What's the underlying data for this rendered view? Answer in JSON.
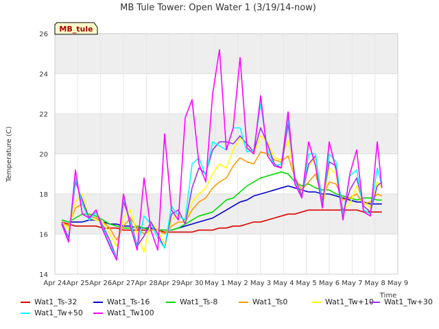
{
  "chart_data": {
    "type": "line",
    "title": "MB Tule Tower: Open Water 1 (3/19/14-now)",
    "xlabel": "Time",
    "ylabel": "Temperature (C)",
    "ylim": [
      14,
      26
    ],
    "yticks": [
      14,
      16,
      18,
      20,
      22,
      24,
      26
    ],
    "xticks": [
      "Apr 24",
      "Apr 25",
      "Apr 26",
      "Apr 27",
      "Apr 28",
      "Apr 29",
      "Apr 30",
      "May 1",
      "May 2",
      "May 3",
      "May 4",
      "May 5",
      "May 6",
      "May 7",
      "May 8",
      "May 9"
    ],
    "xlim_days": [
      0,
      15
    ],
    "station_label": "MB_tule",
    "legend_position": "bottom",
    "grid": true,
    "x": [
      0.3,
      0.6,
      0.9,
      1.2,
      1.5,
      1.8,
      2.1,
      2.4,
      2.7,
      3.0,
      3.3,
      3.6,
      3.9,
      4.2,
      4.5,
      4.8,
      5.1,
      5.4,
      5.7,
      6.0,
      6.3,
      6.6,
      6.9,
      7.2,
      7.5,
      7.8,
      8.1,
      8.4,
      8.7,
      9.0,
      9.3,
      9.6,
      9.9,
      10.2,
      10.5,
      10.8,
      11.1,
      11.4,
      11.7,
      12.0,
      12.3,
      12.6,
      12.9,
      13.2,
      13.5,
      13.8,
      14.1,
      14.3
    ],
    "series": [
      {
        "name": "Wat1_Ts-32",
        "color": "#dd0000",
        "values": [
          16.6,
          16.5,
          16.4,
          16.4,
          16.4,
          16.4,
          16.3,
          16.3,
          16.3,
          16.2,
          16.2,
          16.2,
          16.2,
          16.2,
          16.2,
          16.1,
          16.1,
          16.1,
          16.1,
          16.1,
          16.2,
          16.2,
          16.2,
          16.3,
          16.3,
          16.4,
          16.4,
          16.5,
          16.6,
          16.6,
          16.7,
          16.8,
          16.9,
          17.0,
          17.0,
          17.1,
          17.2,
          17.2,
          17.2,
          17.2,
          17.2,
          17.2,
          17.2,
          17.2,
          17.1,
          17.1,
          17.1,
          17.1
        ]
      },
      {
        "name": "Wat1_Ts-16",
        "color": "#0000cc",
        "values": [
          16.7,
          16.6,
          16.6,
          16.6,
          16.7,
          16.7,
          16.6,
          16.5,
          16.5,
          16.4,
          16.4,
          16.3,
          16.3,
          16.3,
          16.2,
          16.2,
          16.2,
          16.3,
          16.4,
          16.5,
          16.6,
          16.7,
          16.8,
          17.0,
          17.2,
          17.4,
          17.6,
          17.7,
          17.9,
          18.0,
          18.1,
          18.2,
          18.3,
          18.4,
          18.3,
          18.2,
          18.1,
          18.1,
          18.0,
          18.0,
          17.9,
          17.8,
          17.7,
          17.6,
          17.6,
          17.5,
          17.5,
          17.5
        ]
      },
      {
        "name": "Wat1_Ts-8",
        "color": "#00dd00",
        "values": [
          16.7,
          16.6,
          16.8,
          17.0,
          17.0,
          16.9,
          16.7,
          16.5,
          16.4,
          16.3,
          16.3,
          16.4,
          16.3,
          16.2,
          16.2,
          16.2,
          16.2,
          16.3,
          16.5,
          16.7,
          16.9,
          17.0,
          17.1,
          17.4,
          17.7,
          17.8,
          18.1,
          18.4,
          18.6,
          18.8,
          18.9,
          19.0,
          19.1,
          19.0,
          18.6,
          18.4,
          18.5,
          18.3,
          18.2,
          18.2,
          18.0,
          17.9,
          17.8,
          17.7,
          17.8,
          17.8,
          17.7,
          17.7
        ]
      },
      {
        "name": "Wat1_Ts0",
        "color": "#ff9900",
        "values": [
          16.6,
          16.4,
          17.3,
          17.5,
          16.9,
          16.8,
          16.6,
          16.3,
          15.7,
          16.4,
          16.8,
          16.3,
          16.0,
          16.2,
          16.2,
          16.0,
          16.4,
          16.6,
          16.6,
          17.2,
          17.6,
          17.8,
          18.3,
          18.6,
          18.8,
          19.4,
          19.8,
          19.6,
          19.5,
          20.1,
          20.0,
          19.7,
          19.6,
          19.9,
          18.8,
          18.2,
          18.6,
          19.0,
          17.8,
          18.6,
          18.5,
          17.7,
          17.8,
          18.0,
          17.5,
          17.6,
          18.0,
          17.9
        ]
      },
      {
        "name": "Wat1_Tw+10",
        "color": "#ffff00",
        "values": [
          16.6,
          16.2,
          17.6,
          18.0,
          16.8,
          16.7,
          16.6,
          16.0,
          15.4,
          16.8,
          17.2,
          16.0,
          15.1,
          16.6,
          16.2,
          15.5,
          16.7,
          17.0,
          16.6,
          17.6,
          18.0,
          18.3,
          19.0,
          19.5,
          19.3,
          20.2,
          20.8,
          20.3,
          20.0,
          20.9,
          20.6,
          19.8,
          19.7,
          20.7,
          18.7,
          18.0,
          19.4,
          19.8,
          17.3,
          19.3,
          19.0,
          17.2,
          17.5,
          18.4,
          17.6,
          17.3,
          18.6,
          18.3
        ]
      },
      {
        "name": "Wat1_Tw+30",
        "color": "#9933ee",
        "values": [
          16.6,
          15.8,
          18.6,
          17.7,
          16.8,
          17.1,
          16.4,
          15.7,
          14.8,
          17.6,
          16.7,
          15.4,
          15.9,
          16.6,
          16.0,
          15.3,
          17.0,
          17.2,
          16.5,
          18.3,
          19.3,
          19.0,
          20.2,
          20.6,
          20.6,
          20.5,
          20.9,
          20.5,
          20.1,
          21.3,
          20.5,
          19.5,
          19.3,
          21.5,
          18.8,
          17.9,
          19.5,
          19.9,
          17.6,
          19.6,
          19.4,
          17.1,
          18.2,
          18.8,
          17.4,
          17.1,
          18.4,
          18.6
        ]
      },
      {
        "name": "Wat1_Tw+50",
        "color": "#00ffff",
        "values": [
          16.5,
          15.7,
          18.8,
          17.5,
          16.7,
          17.1,
          16.3,
          15.5,
          14.8,
          17.8,
          16.6,
          15.3,
          16.9,
          16.5,
          15.8,
          15.3,
          17.4,
          16.9,
          16.7,
          19.5,
          19.8,
          18.9,
          20.6,
          20.4,
          20.2,
          21.3,
          21.3,
          20.1,
          20.2,
          22.5,
          20.2,
          19.4,
          19.5,
          21.8,
          18.6,
          17.8,
          20.0,
          20.0,
          17.4,
          20.0,
          19.6,
          16.9,
          18.9,
          19.2,
          17.2,
          17.0,
          19.3,
          18.4
        ]
      },
      {
        "name": "Wat1_Tw100",
        "color": "#ff00ff",
        "values": [
          16.5,
          15.6,
          19.2,
          17.0,
          16.8,
          17.2,
          16.2,
          15.4,
          14.7,
          18.0,
          16.4,
          15.2,
          18.8,
          16.2,
          15.2,
          21.0,
          17.2,
          16.7,
          21.8,
          22.7,
          19.5,
          18.6,
          23.0,
          25.2,
          20.2,
          21.3,
          24.8,
          20.3,
          20.0,
          22.9,
          19.9,
          19.4,
          19.3,
          22.1,
          18.5,
          17.8,
          20.6,
          19.4,
          17.3,
          20.6,
          19.2,
          16.7,
          19.0,
          20.2,
          17.1,
          16.9,
          20.6,
          18.3
        ]
      }
    ]
  }
}
